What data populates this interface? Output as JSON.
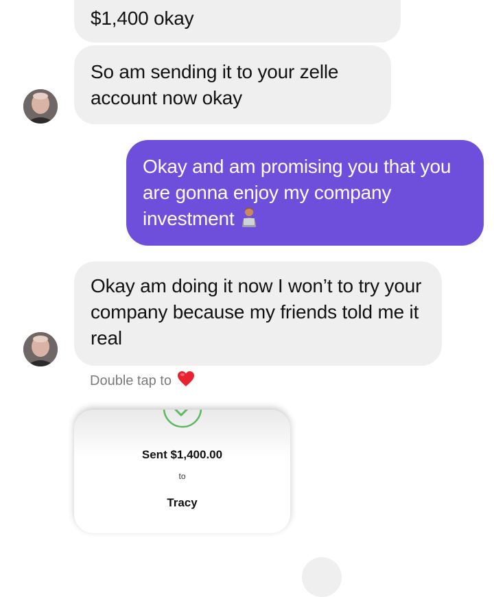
{
  "messages": [
    {
      "direction": "incoming",
      "text": "$1,400 okay"
    },
    {
      "direction": "incoming",
      "text": "So am sending it to your zelle account now okay"
    },
    {
      "direction": "outgoing",
      "text": "Okay and am promising you that you are gonna enjoy my company investment",
      "emoji": "person-with-laptop-emoji"
    },
    {
      "direction": "incoming",
      "text": "Okay am doing it now I won’t to try your company because my friends told me it real"
    }
  ],
  "reaction_hint": {
    "text": "Double tap to",
    "icon": "heart-icon"
  },
  "payment_card": {
    "amount": "Sent $1,400.00",
    "to": "to",
    "recipient": "Tracy",
    "icon": "check-circle-icon"
  },
  "colors": {
    "incoming_bubble": "#efefef",
    "outgoing_bubble": "#6d4fdc",
    "check": "#5fb85f",
    "heart": "#e8232f"
  }
}
